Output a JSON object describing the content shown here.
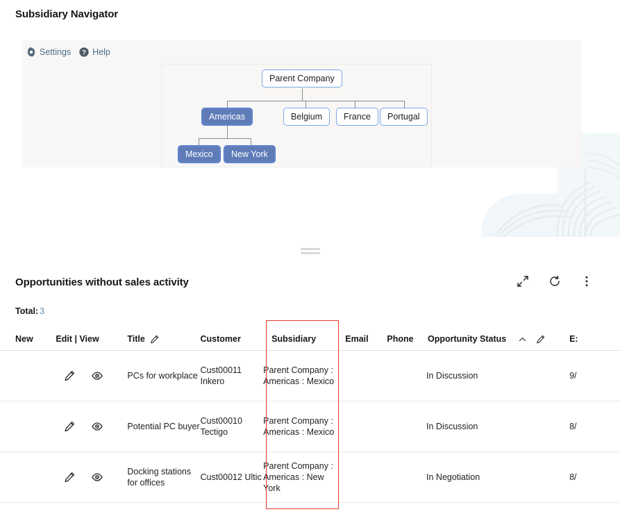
{
  "gadget": {
    "title": "Subsidiary Navigator",
    "toolbar": {
      "settings_label": "Settings",
      "settings_icon": "gear-icon",
      "help_label": "Help",
      "help_icon": "question-circle-icon"
    },
    "tree": {
      "root": "Parent Company",
      "nodes": [
        {
          "label": "Parent Company",
          "selected": false,
          "level": 0
        },
        {
          "label": "Americas",
          "selected": true,
          "level": 1
        },
        {
          "label": "Belgium",
          "selected": false,
          "level": 1
        },
        {
          "label": "France",
          "selected": false,
          "level": 1
        },
        {
          "label": "Portugal",
          "selected": false,
          "level": 1
        },
        {
          "label": "Mexico",
          "selected": true,
          "level": 2
        },
        {
          "label": "New York",
          "selected": true,
          "level": 2
        }
      ]
    }
  },
  "splitter": {
    "handle_icon": "drag-handle-icon"
  },
  "table_panel": {
    "title": "Opportunities without sales activity",
    "actions": [
      {
        "name": "expand-icon",
        "label": "Expand"
      },
      {
        "name": "refresh-icon",
        "label": "Refresh"
      },
      {
        "name": "more-options-icon",
        "label": "More options"
      }
    ],
    "total_label": "Total:",
    "total_value": "3",
    "columns": [
      {
        "key": "new",
        "label": "New"
      },
      {
        "key": "edit_view",
        "label": "Edit | View"
      },
      {
        "key": "title",
        "label": "Title",
        "edit_icon": "pencil-icon"
      },
      {
        "key": "customer",
        "label": "Customer"
      },
      {
        "key": "subsidiary",
        "label": "Subsidiary"
      },
      {
        "key": "email",
        "label": "Email"
      },
      {
        "key": "phone",
        "label": "Phone"
      },
      {
        "key": "status",
        "label": "Opportunity Status",
        "sort_icon": "chevron-up-icon",
        "edit_icon": "pencil-icon"
      },
      {
        "key": "expected",
        "label": "E:"
      }
    ],
    "rows": [
      {
        "edit_icon": "pencil-icon",
        "view_icon": "eye-icon",
        "title": "PCs for workplace",
        "customer": "Cust00011 Inkero",
        "subsidiary": "Parent Company : Americas : Mexico",
        "email": "",
        "phone": "",
        "status": "In Discussion",
        "expected": "9/"
      },
      {
        "edit_icon": "pencil-icon",
        "view_icon": "eye-icon",
        "title": "Potential PC buyer",
        "customer": "Cust00010 Tectigo",
        "subsidiary": "Parent Company : Americas : Mexico",
        "email": "",
        "phone": "",
        "status": "In Discussion",
        "expected": "8/"
      },
      {
        "edit_icon": "pencil-icon",
        "view_icon": "eye-icon",
        "title": "Docking stations for offices",
        "customer": "Cust00012 Ultic",
        "subsidiary": "Parent Company : Americas : New York",
        "email": "",
        "phone": "",
        "status": "In Negotiation",
        "expected": "8/"
      }
    ]
  },
  "annotation": {
    "name": "subsidiary-column-highlight",
    "color": "#e8392e"
  },
  "colors": {
    "selected_node_fill": "#5f7cb8",
    "node_border": "#7ba7e8",
    "link": "#5a8ab5",
    "panel_bg": "#f8f7f6",
    "accent_red": "#e8392e"
  }
}
